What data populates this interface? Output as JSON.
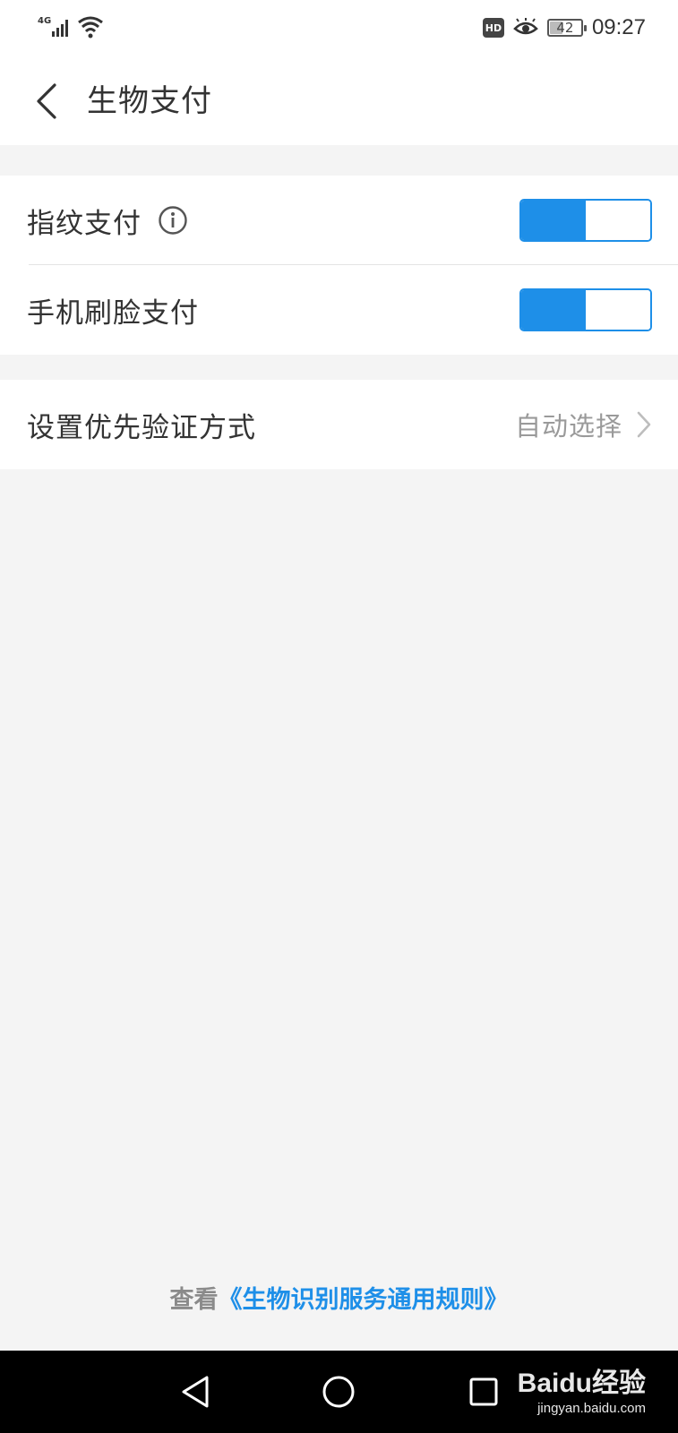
{
  "status_bar": {
    "network": "4G",
    "hd_label": "HD",
    "battery_percent": 42,
    "battery_text": "42",
    "time": "09:27"
  },
  "header": {
    "title": "生物支付",
    "back_icon": "chevron-left-icon"
  },
  "settings": {
    "fingerprint": {
      "label": "指纹支付",
      "enabled": true,
      "info_icon": "info-icon"
    },
    "face": {
      "label": "手机刷脸支付",
      "enabled": true
    },
    "priority": {
      "label": "设置优先验证方式",
      "value": "自动选择",
      "icon": "chevron-right-icon"
    }
  },
  "footer": {
    "prefix": "查看",
    "link_text": "《生物识别服务通用规则》"
  },
  "nav_bar": {
    "back_icon": "triangle-back-icon",
    "home_icon": "circle-home-icon",
    "recent_icon": "square-recent-icon"
  },
  "watermark": {
    "logo": "Baidu经验",
    "url": "jingyan.baidu.com"
  },
  "colors": {
    "accent": "#1e8fe8",
    "background": "#f4f4f4",
    "card": "#ffffff",
    "text": "#333333",
    "secondary_text": "#9a9a9a"
  }
}
